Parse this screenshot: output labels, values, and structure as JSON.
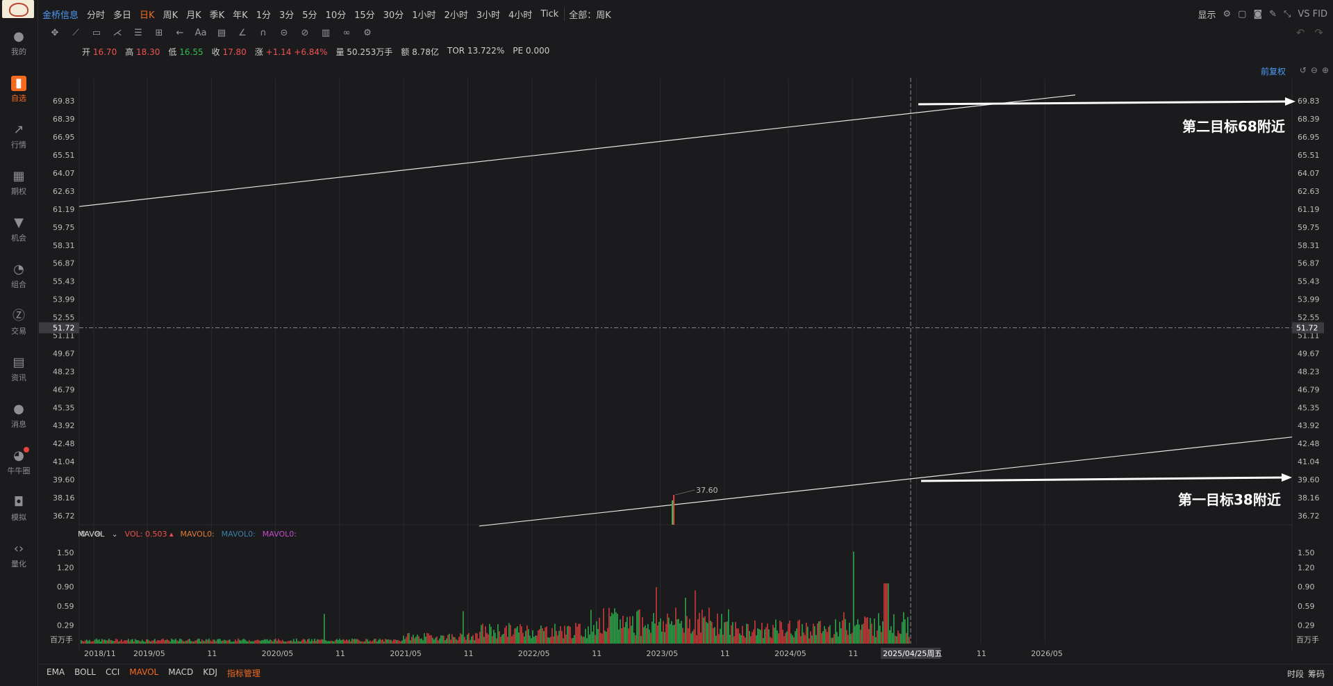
{
  "sidebar": {
    "items": [
      {
        "label": "我的",
        "icon": "user-icon"
      },
      {
        "label": "自选",
        "icon": "bar-chart-icon",
        "active": true
      },
      {
        "label": "行情",
        "icon": "trend-icon"
      },
      {
        "label": "期权",
        "icon": "options-icon"
      },
      {
        "label": "机会",
        "icon": "funnel-icon"
      },
      {
        "label": "组合",
        "icon": "pie-icon"
      },
      {
        "label": "交易",
        "icon": "trade-icon"
      },
      {
        "label": "资讯",
        "icon": "news-icon"
      },
      {
        "label": "消息",
        "icon": "message-icon"
      },
      {
        "label": "牛牛圈",
        "icon": "community-icon"
      },
      {
        "label": "模拟",
        "icon": "gamepad-icon"
      },
      {
        "label": "量化",
        "icon": "code-icon"
      }
    ]
  },
  "topbar": {
    "brand": "金桥信息",
    "periods": [
      "分时",
      "多日",
      "日K",
      "周K",
      "月K",
      "季K",
      "年K",
      "1分",
      "3分",
      "5分",
      "10分",
      "15分",
      "30分",
      "1小时",
      "2小时",
      "3小时",
      "4小时",
      "Tick"
    ],
    "active_period": "日K",
    "scope": "全部：周K",
    "display": "显示",
    "vs": "VS FID"
  },
  "ohlc": {
    "open_label": "开",
    "open": "16.70",
    "high_label": "高",
    "high": "18.30",
    "low_label": "低",
    "low": "16.55",
    "close_label": "收",
    "close": "17.80",
    "change_label": "涨",
    "change": "+1.14",
    "change_pct": "+6.84%",
    "volume_label": "量",
    "volume": "50.253万手",
    "amount_label": "额",
    "amount": "8.78亿",
    "tor_label": "TOR",
    "tor": "13.722%",
    "pe_label": "PE",
    "pe": "0.000"
  },
  "price_adjust": "前复权",
  "indicator": {
    "name": "MAVOL",
    "vol_label": "VOL:",
    "vol_value": "0.503",
    "mavol1": "MAVOL0:",
    "mavol2": "MAVOL0:",
    "mavol3": "MAVOL0:",
    "unit": "百万手"
  },
  "annotations": {
    "target2": "第二目标68附近",
    "target1": "第一目标38附近",
    "peak_label": "37.60"
  },
  "crosshair": {
    "price": "51.72",
    "date": "2025/04/25周五"
  },
  "bottom": {
    "tabs": [
      "EMA",
      "BOLL",
      "CCI",
      "MAVOL",
      "MACD",
      "KDJ"
    ],
    "active": "MAVOL",
    "manage": "指标管理",
    "right": [
      "时段",
      "筹码"
    ]
  },
  "chart_data": {
    "type": "bar",
    "price_axis": {
      "ticks": [
        "69.83",
        "68.39",
        "66.95",
        "65.51",
        "64.07",
        "62.63",
        "61.19",
        "59.75",
        "58.31",
        "56.87",
        "55.43",
        "53.99",
        "52.55",
        "51.11",
        "49.67",
        "48.23",
        "46.79",
        "45.35",
        "43.92",
        "42.48",
        "41.04",
        "39.60",
        "38.16",
        "36.72"
      ],
      "ylim": [
        36.0,
        70.5
      ]
    },
    "volume_axis": {
      "ticks": [
        "1.50",
        "1.20",
        "0.90",
        "0.59",
        "0.29"
      ],
      "ylim": [
        0,
        1.6
      ]
    },
    "x_ticks": [
      "2018/11",
      "2019/05",
      "11",
      "2020/05",
      "11",
      "2021/05",
      "11",
      "2022/05",
      "11",
      "2023/05",
      "11",
      "2024/05",
      "11",
      "2025/05",
      "11",
      "2026/05"
    ],
    "colors": {
      "up": "#e8413f",
      "down": "#2fbd52",
      "line": "#e6e6e6",
      "grid": "#2b2b2e"
    },
    "trendlines": [
      {
        "name": "upper",
        "points": [
          [
            "2018/11",
            61.4
          ],
          [
            "2025/12",
            70.3
          ]
        ]
      },
      {
        "name": "lower",
        "points": [
          [
            "2021/11",
            35.9
          ],
          [
            "2026/12",
            43.0
          ]
        ]
      }
    ]
  }
}
